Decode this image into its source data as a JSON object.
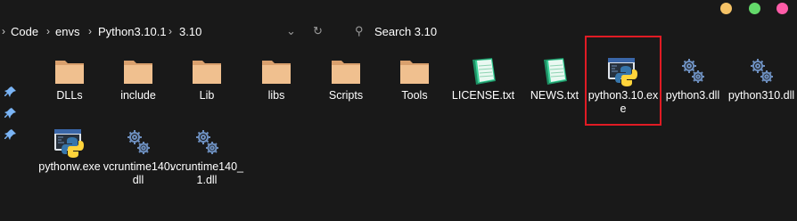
{
  "window_controls": [
    {
      "name": "minimize",
      "color": "#f5c266"
    },
    {
      "name": "maximize",
      "color": "#63d96a"
    },
    {
      "name": "close",
      "color": "#ff5ca8"
    }
  ],
  "breadcrumb": [
    "Code",
    "envs",
    "Python3.10.1",
    "3.10"
  ],
  "search": {
    "placeholder": "Search 3.10"
  },
  "icons": {
    "folder": "folder-icon",
    "notepad": "notepad-document-icon",
    "python": "python-executable-icon",
    "gear": "dll-gear-icon",
    "pin": "pin-icon"
  },
  "files": [
    {
      "name": "DLLs",
      "type": "folder"
    },
    {
      "name": "include",
      "type": "folder"
    },
    {
      "name": "Lib",
      "type": "folder"
    },
    {
      "name": "libs",
      "type": "folder"
    },
    {
      "name": "Scripts",
      "type": "folder"
    },
    {
      "name": "Tools",
      "type": "folder"
    },
    {
      "name": "LICENSE.txt",
      "type": "notepad"
    },
    {
      "name": "NEWS.txt",
      "type": "notepad"
    },
    {
      "name": "python3.10.exe",
      "type": "python",
      "highlighted": true
    },
    {
      "name": "python3.dll",
      "type": "gear"
    },
    {
      "name": "python310.dll",
      "type": "gear"
    },
    {
      "name": "pythonw.exe",
      "type": "python"
    },
    {
      "name": "vcruntime140.dll",
      "type": "gear"
    },
    {
      "name": "vcruntime140_1.dll",
      "type": "gear"
    }
  ],
  "highlight_color": "#e01b24"
}
